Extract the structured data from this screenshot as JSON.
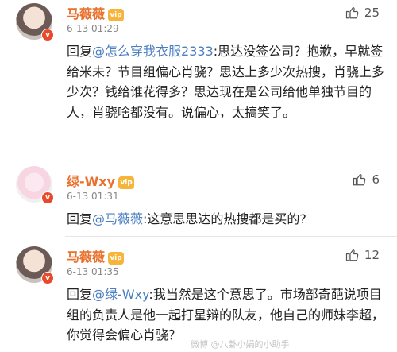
{
  "comments": [
    {
      "username": "马薇薇",
      "vip_badge": "vip",
      "time": "6-13 01:29",
      "likes": "25",
      "reply_prefix": "回复",
      "mention": "@怎么穿我衣服2333",
      "text": ":思达没签公司？抱歉，早就签给米未？节目组偏心肖骁？思达上多少次热搜，肖骁上多少次？钱给谁花得多？思达现在是公司给他单独节目的人，肖骁啥都没有。说偏心，太搞笑了。"
    },
    {
      "username": "绿-Wxy",
      "vip_badge": "vip",
      "time": "6-13 01:31",
      "likes": "6",
      "reply_prefix": "回复",
      "mention": "@马薇薇",
      "text": ":这意思思达的热搜都是买的?"
    },
    {
      "username": "马薇薇",
      "vip_badge": "vip",
      "time": "6-13 01:35",
      "likes": "12",
      "reply_prefix": "回复",
      "mention": "@绿-Wxy",
      "text": ":我当然是这个意思了。市场部奇葩说项目组的负责人是他一起打星辩的队友，他自己的师妹李超，你觉得会偏心肖骁？"
    }
  ],
  "watermark": "微博 @八卦小娟的小助手"
}
